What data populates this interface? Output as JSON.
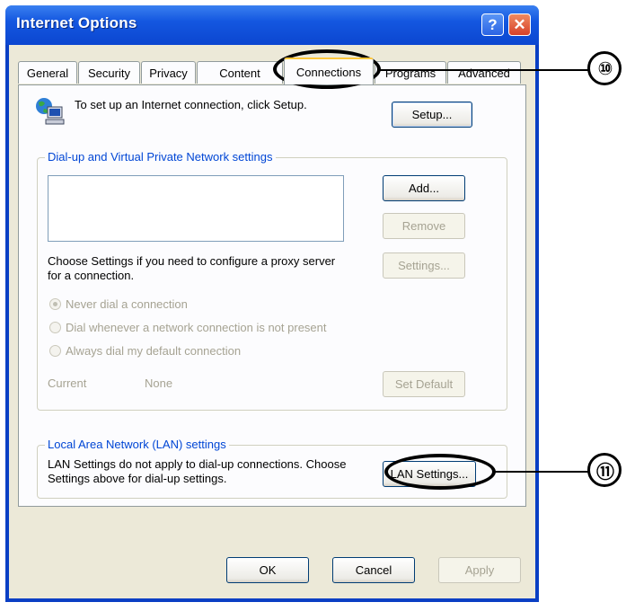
{
  "window": {
    "title": "Internet Options",
    "help_glyph": "?",
    "close_glyph": "✕"
  },
  "tabs": [
    "General",
    "Security",
    "Privacy",
    "Content",
    "Connections",
    "Programs",
    "Advanced"
  ],
  "active_tab": "Connections",
  "setup": {
    "description": "To set up an Internet connection, click Setup.",
    "button": "Setup..."
  },
  "dialup": {
    "legend": "Dial-up and Virtual Private Network settings",
    "add": "Add...",
    "remove": "Remove",
    "proxy_text": "Choose Settings if you need to configure a proxy server for a connection.",
    "settings": "Settings...",
    "radios": [
      {
        "label": "Never dial a connection",
        "checked": true
      },
      {
        "label": "Dial whenever a network connection is not present",
        "checked": false
      },
      {
        "label": "Always dial my default connection",
        "checked": false
      }
    ],
    "current_label": "Current",
    "current_value": "None",
    "set_default": "Set Default"
  },
  "lan": {
    "legend": "Local Area Network (LAN) settings",
    "text": "LAN Settings do not apply to dial-up connections. Choose Settings above for dial-up settings.",
    "button": "LAN Settings..."
  },
  "footer": {
    "ok": "OK",
    "cancel": "Cancel",
    "apply": "Apply"
  },
  "callouts": [
    "⑩",
    "⑪"
  ],
  "colors": {
    "titlebar": "#0b46d0",
    "face": "#ece9d8",
    "legend_text": "#0046d5"
  },
  "icons": {
    "connection": "globe-computer-icon"
  }
}
